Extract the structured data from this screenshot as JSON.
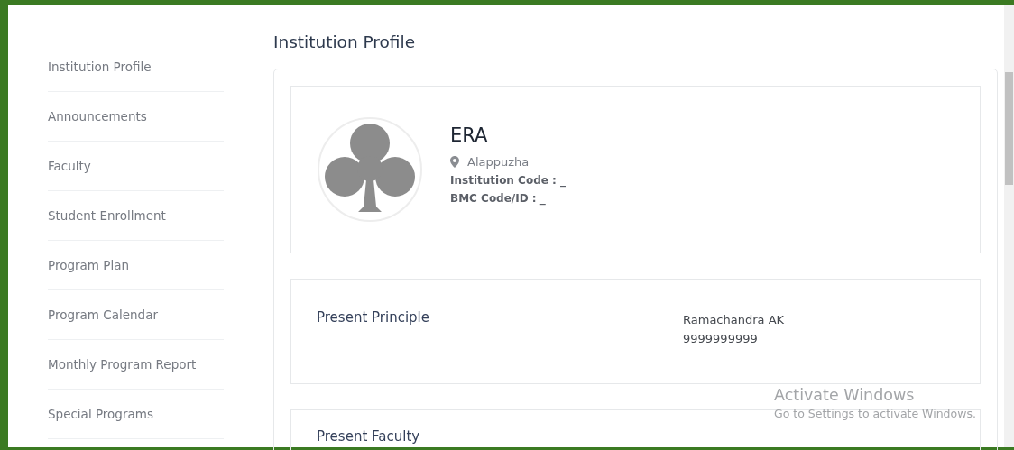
{
  "sidebar": {
    "items": [
      {
        "label": "Institution Profile"
      },
      {
        "label": "Announcements"
      },
      {
        "label": "Faculty"
      },
      {
        "label": "Student Enrollment"
      },
      {
        "label": "Program Plan"
      },
      {
        "label": "Program Calendar"
      },
      {
        "label": "Monthly Program Report"
      },
      {
        "label": "Special Programs"
      }
    ]
  },
  "page_title": "Institution Profile",
  "profile": {
    "name": "ERA",
    "location": "Alappuzha",
    "fields": [
      "Institution Code : _",
      "BMC Code/ID : _"
    ]
  },
  "sections": [
    {
      "heading": "Present Principle",
      "lines": [
        "Ramachandra AK",
        "9999999999"
      ]
    },
    {
      "heading": "Present Faculty"
    }
  ],
  "os_notice": {
    "title": "Activate Windows",
    "subtitle": "Go to Settings to activate Windows."
  }
}
